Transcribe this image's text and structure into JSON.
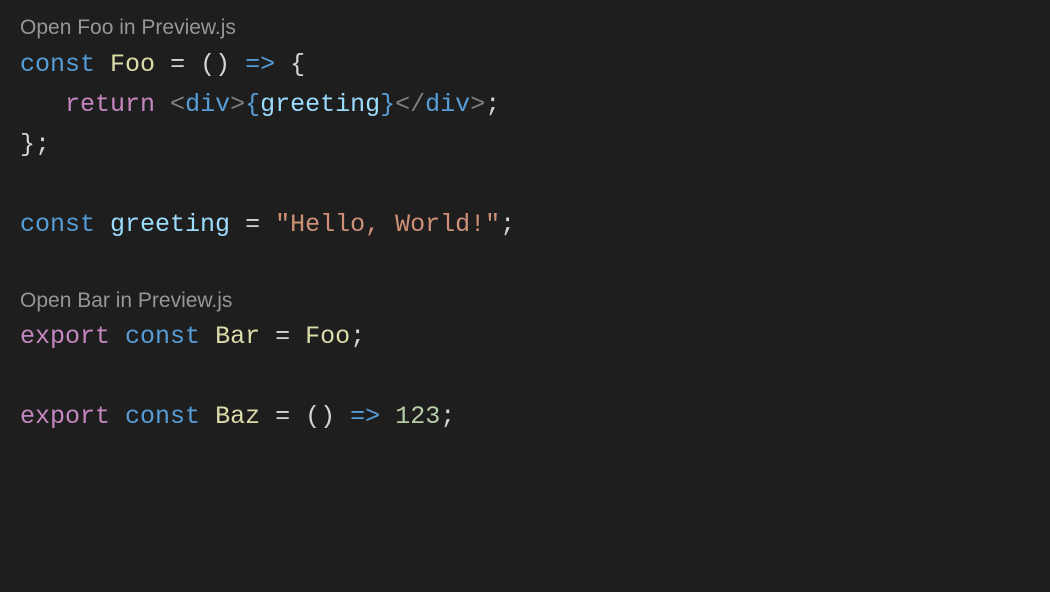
{
  "codelens": {
    "foo": "Open Foo in Preview.js",
    "bar": "Open Bar in Preview.js"
  },
  "code": {
    "line1": {
      "kw_const": "const",
      "sp1": " ",
      "name_foo": "Foo",
      "sp2": " ",
      "eq": "=",
      "sp3": " ",
      "parens": "()",
      "sp4": " ",
      "arrow": "=>",
      "sp5": " ",
      "brace_open": "{"
    },
    "line2": {
      "indent": "   ",
      "kw_return": "return",
      "sp1": " ",
      "tag_open_lt": "<",
      "tag_open_name": "div",
      "tag_open_gt": ">",
      "brace_open": "{",
      "expr": "greeting",
      "brace_close": "}",
      "tag_close_lt": "</",
      "tag_close_name": "div",
      "tag_close_gt": ">",
      "semi": ";"
    },
    "line3": {
      "brace_close": "}",
      "semi": ";"
    },
    "line4": {
      "kw_const": "const",
      "sp1": " ",
      "name_greeting": "greeting",
      "sp2": " ",
      "eq": "=",
      "sp3": " ",
      "str": "\"Hello, World!\"",
      "semi": ";"
    },
    "line5": {
      "kw_export": "export",
      "sp1": " ",
      "kw_const": "const",
      "sp2": " ",
      "name_bar": "Bar",
      "sp3": " ",
      "eq": "=",
      "sp4": " ",
      "name_foo": "Foo",
      "semi": ";"
    },
    "line6": {
      "kw_export": "export",
      "sp1": " ",
      "kw_const": "const",
      "sp2": " ",
      "name_baz": "Baz",
      "sp3": " ",
      "eq": "=",
      "sp4": " ",
      "parens": "()",
      "sp5": " ",
      "arrow": "=>",
      "sp6": " ",
      "num": "123",
      "semi": ";"
    }
  }
}
